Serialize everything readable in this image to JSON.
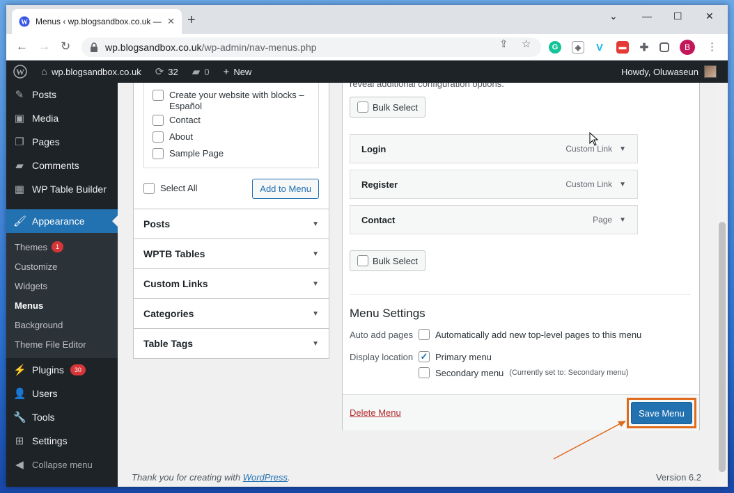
{
  "browser": {
    "tab_title": "Menus ‹ wp.blogsandbox.co.uk —",
    "url_host": "wp.blogsandbox.co.uk",
    "url_path": "/wp-admin/nav-menus.php",
    "profile_initial": "B"
  },
  "adminbar": {
    "site_name": "wp.blogsandbox.co.uk",
    "updates_count": "32",
    "comments_count": "0",
    "new_label": "New",
    "howdy": "Howdy, Oluwaseun"
  },
  "sidebar": {
    "items_top": [
      {
        "label": "Posts",
        "icon": "pin-icon"
      },
      {
        "label": "Media",
        "icon": "media-icon"
      },
      {
        "label": "Pages",
        "icon": "pages-icon"
      },
      {
        "label": "Comments",
        "icon": "comment-icon"
      },
      {
        "label": "WP Table Builder",
        "icon": "table-icon"
      }
    ],
    "current": "Appearance",
    "submenu": [
      {
        "label": "Themes",
        "badge": "1"
      },
      {
        "label": "Customize"
      },
      {
        "label": "Widgets"
      },
      {
        "label": "Menus"
      },
      {
        "label": "Background"
      },
      {
        "label": "Theme File Editor"
      }
    ],
    "items_bottom": [
      {
        "label": "Plugins",
        "badge": "30"
      },
      {
        "label": "Users"
      },
      {
        "label": "Tools"
      },
      {
        "label": "Settings"
      }
    ],
    "collapse": "Collapse menu"
  },
  "left_panel": {
    "pages": [
      "Create your website with blocks – Español",
      "Contact",
      "About",
      "Sample Page"
    ],
    "select_all": "Select All",
    "add_to_menu": "Add to Menu",
    "accordions": [
      "Posts",
      "WPTB Tables",
      "Custom Links",
      "Categories",
      "Table Tags"
    ]
  },
  "menu_structure": {
    "cut_text": "reveal additional configuration options.",
    "bulk_select": "Bulk Select",
    "items": [
      {
        "title": "Login",
        "type": "Custom Link"
      },
      {
        "title": "Register",
        "type": "Custom Link"
      },
      {
        "title": "Contact",
        "type": "Page"
      }
    ]
  },
  "menu_settings": {
    "title": "Menu Settings",
    "auto_add_label": "Auto add pages",
    "auto_add_option": "Automatically add new top-level pages to this menu",
    "display_location_label": "Display location",
    "primary": "Primary menu",
    "secondary": "Secondary menu",
    "secondary_note": "(Currently set to: Secondary menu)"
  },
  "footer": {
    "delete_menu": "Delete Menu",
    "save_menu": "Save Menu",
    "thanks_prefix": "Thank you for creating with ",
    "wordpress": "WordPress",
    "thanks_suffix": ".",
    "version": "Version 6.2"
  },
  "colors": {
    "admin_dark": "#1d2327",
    "primary_blue": "#2271b1",
    "highlight_orange": "#e06a1c",
    "delete_red": "#b32d2e"
  }
}
